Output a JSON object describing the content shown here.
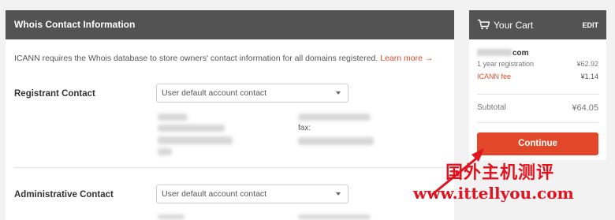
{
  "whois": {
    "title": "Whois Contact Information",
    "info_text": "ICANN requires the Whois database to store owners' contact information for all domains registered.",
    "learn_more": "Learn more →",
    "registrant": {
      "label": "Registrant Contact",
      "select_value": "User default account contact",
      "fax_label": "fax:"
    },
    "administrative": {
      "label": "Administrative Contact",
      "select_value": "User default account contact"
    }
  },
  "cart": {
    "title": "Your Cart",
    "edit": "EDIT",
    "domain_suffix": "com",
    "registration_label": "1 year registration",
    "registration_price": "¥62.92",
    "icann_fee_label": "ICANN fee",
    "icann_fee_price": "¥1.14",
    "subtotal_label": "Subtotal",
    "subtotal_value": "¥64.05",
    "continue_label": "Continue"
  },
  "watermark": {
    "chinese": "国外主机测评",
    "url": "www.ittellyou.com"
  },
  "colors": {
    "header_bg": "#535353",
    "accent": "#e2472a",
    "watermark": "#e0141e"
  }
}
